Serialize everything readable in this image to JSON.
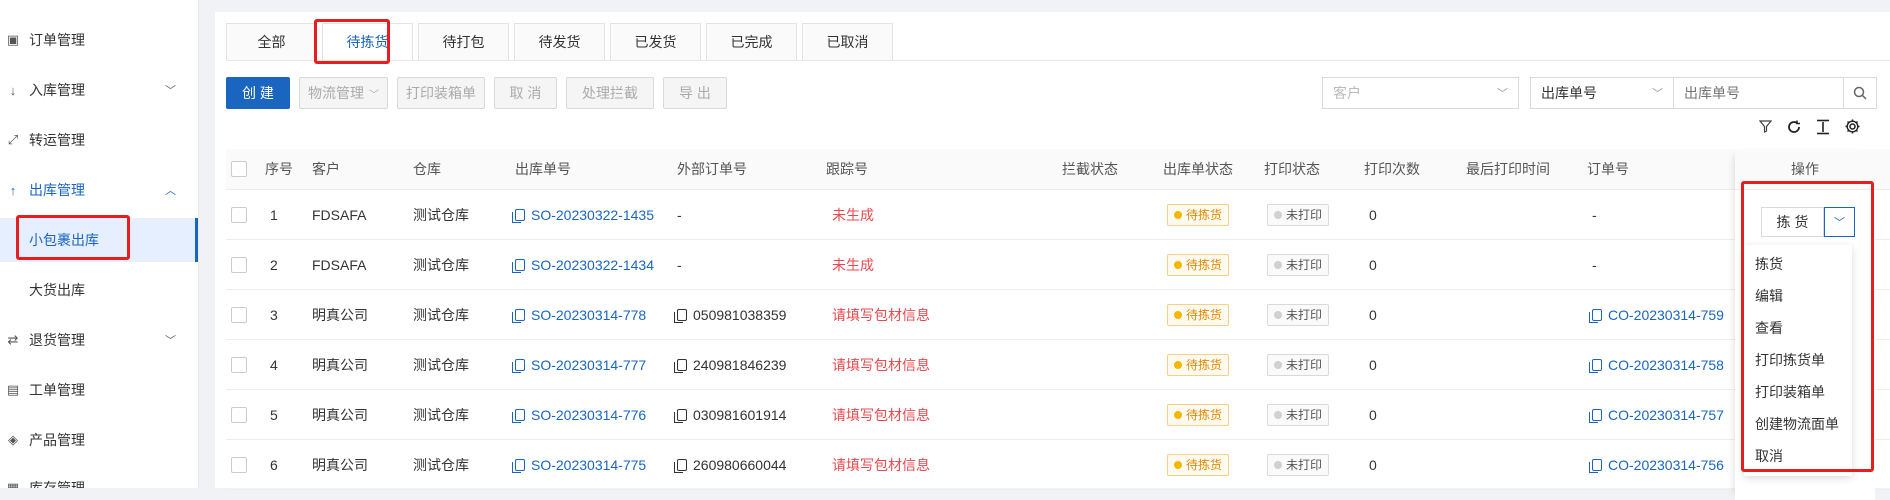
{
  "sidebar": {
    "items": [
      {
        "label": "订单管理",
        "icon": "order-icon"
      },
      {
        "label": "入库管理",
        "icon": "inbound-icon"
      },
      {
        "label": "转运管理",
        "icon": "transfer-icon"
      },
      {
        "label": "出库管理",
        "icon": "outbound-icon"
      },
      {
        "label": "小包裹出库"
      },
      {
        "label": "大货出库"
      },
      {
        "label": "退货管理",
        "icon": "return-icon"
      },
      {
        "label": "工单管理",
        "icon": "workorder-icon"
      },
      {
        "label": "产品管理",
        "icon": "product-icon"
      },
      {
        "label": "库存管理",
        "icon": "inventory-icon"
      }
    ]
  },
  "tabs": [
    "全部",
    "待拣货",
    "待打包",
    "待发货",
    "已发货",
    "已完成",
    "已取消"
  ],
  "active_tab": "待拣货",
  "toolbar": {
    "create": "创 建",
    "logistics": "物流管理",
    "print_box": "打印装箱单",
    "cancel": "取 消",
    "intercept": "处理拦截",
    "export": "导 出"
  },
  "search": {
    "customer_placeholder": "客户",
    "field_select": "出库单号",
    "input_placeholder": "出库单号"
  },
  "table": {
    "headers": [
      "序号",
      "客户",
      "仓库",
      "出库单号",
      "外部订单号",
      "跟踪号",
      "拦截状态",
      "出库单状态",
      "打印状态",
      "打印次数",
      "最后打印时间",
      "订单号"
    ],
    "rows": [
      {
        "no": "1",
        "customer": "FDSAFA",
        "warehouse": "测试仓库",
        "outbound_no": "SO-20230322-1435",
        "external_no": "-",
        "tracking": "未生成",
        "intercept": "",
        "status": "待拣货",
        "print_status": "未打印",
        "print_count": "0",
        "last_print": "",
        "order_no": "-"
      },
      {
        "no": "2",
        "customer": "FDSAFA",
        "warehouse": "测试仓库",
        "outbound_no": "SO-20230322-1434",
        "external_no": "-",
        "tracking": "未生成",
        "intercept": "",
        "status": "待拣货",
        "print_status": "未打印",
        "print_count": "0",
        "last_print": "",
        "order_no": "-"
      },
      {
        "no": "3",
        "customer": "明真公司",
        "warehouse": "测试仓库",
        "outbound_no": "SO-20230314-778",
        "external_no": "050981038359",
        "tracking": "请填写包材信息",
        "intercept": "",
        "status": "待拣货",
        "print_status": "未打印",
        "print_count": "0",
        "last_print": "",
        "order_no": "CO-20230314-759"
      },
      {
        "no": "4",
        "customer": "明真公司",
        "warehouse": "测试仓库",
        "outbound_no": "SO-20230314-777",
        "external_no": "240981846239",
        "tracking": "请填写包材信息",
        "intercept": "",
        "status": "待拣货",
        "print_status": "未打印",
        "print_count": "0",
        "last_print": "",
        "order_no": "CO-20230314-758"
      },
      {
        "no": "5",
        "customer": "明真公司",
        "warehouse": "测试仓库",
        "outbound_no": "SO-20230314-776",
        "external_no": "030981601914",
        "tracking": "请填写包材信息",
        "intercept": "",
        "status": "待拣货",
        "print_status": "未打印",
        "print_count": "0",
        "last_print": "",
        "order_no": "CO-20230314-757"
      },
      {
        "no": "6",
        "customer": "明真公司",
        "warehouse": "测试仓库",
        "outbound_no": "SO-20230314-775",
        "external_no": "260980660044",
        "tracking": "请填写包材信息",
        "intercept": "",
        "status": "待拣货",
        "print_status": "未打印",
        "print_count": "0",
        "last_print": "",
        "order_no": "CO-20230314-756"
      }
    ]
  },
  "operation": {
    "header": "操作",
    "main_button": "拣 货",
    "menu": [
      "拣货",
      "编辑",
      "查看",
      "打印拣货单",
      "打印装箱单",
      "创建物流面单",
      "取消"
    ]
  },
  "colors": {
    "primary": "#1a65c0",
    "warning_text": "#e8494e",
    "highlight": "#e81d1d"
  }
}
